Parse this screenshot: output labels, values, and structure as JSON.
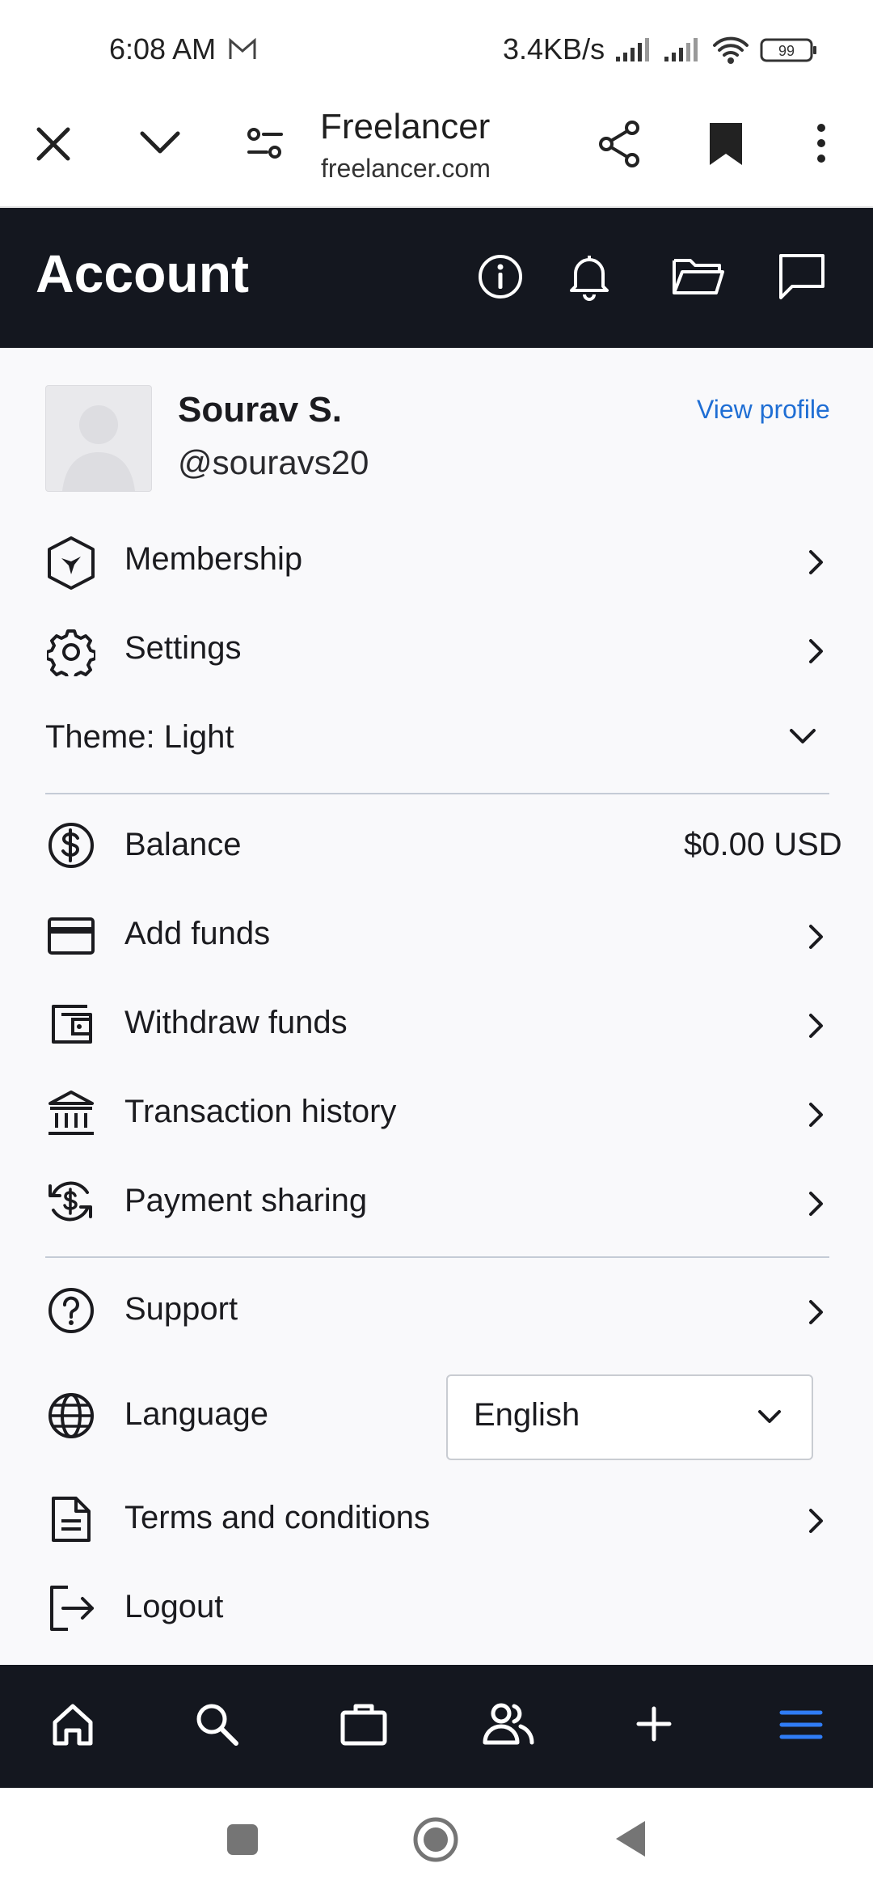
{
  "status_bar": {
    "time": "6:08 AM",
    "network_speed": "3.4KB/s",
    "battery": "99"
  },
  "browser": {
    "title": "Freelancer",
    "url": "freelancer.com"
  },
  "header": {
    "title": "Account"
  },
  "profile": {
    "name": "Sourav S.",
    "handle": "@souravs20",
    "view_profile": "View profile"
  },
  "menu": {
    "membership": "Membership",
    "settings": "Settings",
    "theme": "Theme: Light",
    "balance": "Balance",
    "balance_value": "$0.00 USD",
    "add_funds": "Add funds",
    "withdraw_funds": "Withdraw funds",
    "transaction_history": "Transaction history",
    "payment_sharing": "Payment sharing",
    "support": "Support",
    "language": "Language",
    "language_value": "English",
    "terms": "Terms and conditions",
    "logout": "Logout"
  },
  "colors": {
    "header_bg": "#14171f",
    "link": "#1f6ed4",
    "active_nav": "#2f7cf6"
  }
}
